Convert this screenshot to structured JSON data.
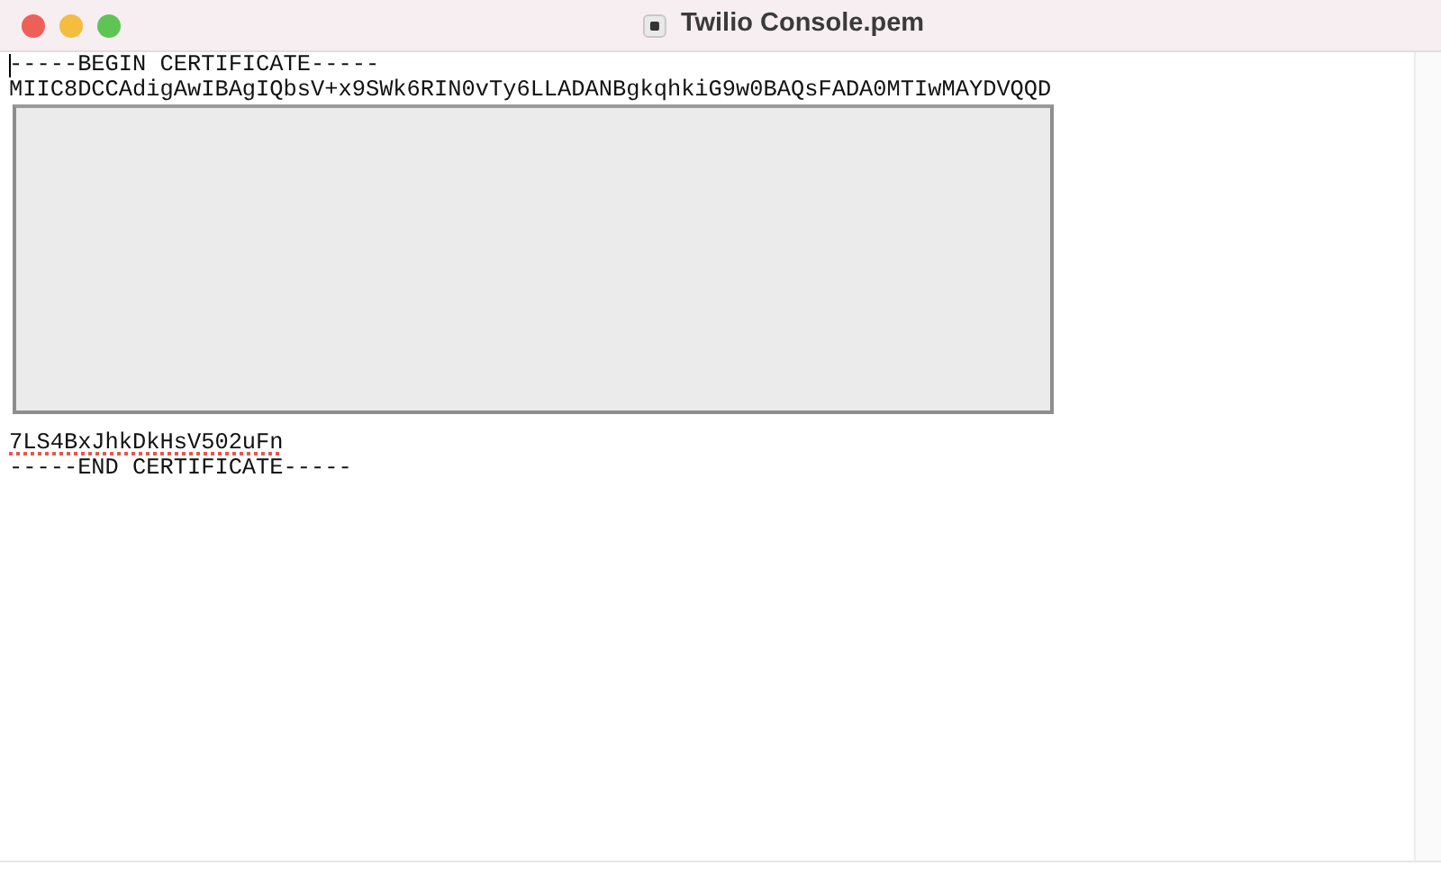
{
  "window": {
    "title": "Twilio Console.pem"
  },
  "editor": {
    "cursor": true,
    "lines": [
      {
        "kind": "text",
        "text": "-----BEGIN CERTIFICATE-----",
        "misspelled": false
      },
      {
        "kind": "text",
        "text": "MIIC8DCCAdigAwIBAgIQbsV+x9SWk6RIN0vTy6LLADANBgkqhkiG9w0BAQsFADA0MTIwMAYDVQQD",
        "misspelled": false
      },
      {
        "kind": "redacted"
      },
      {
        "kind": "text",
        "text": "7LS4BxJhkDkHsV502uFn",
        "misspelled": true
      },
      {
        "kind": "text",
        "text": "-----END CERTIFICATE-----",
        "misspelled": false
      }
    ]
  }
}
